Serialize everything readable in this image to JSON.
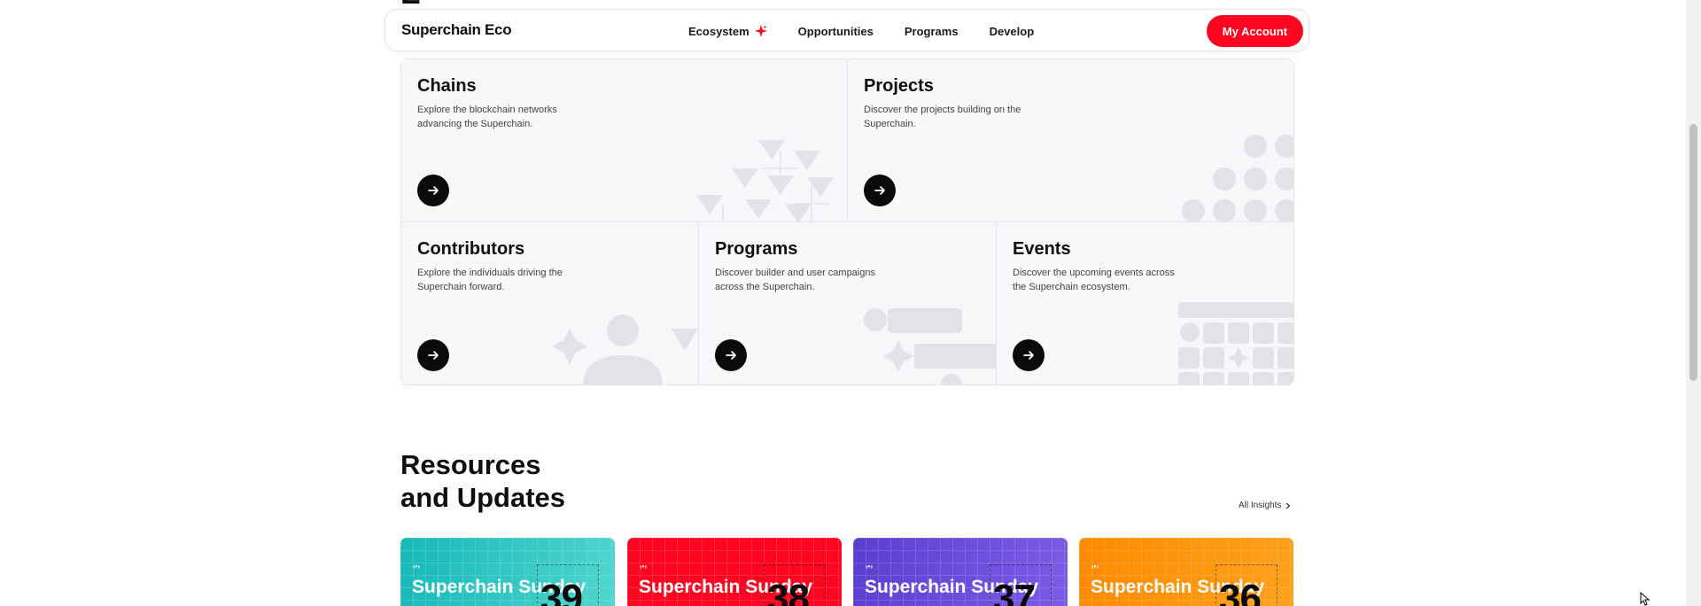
{
  "header": {
    "logo": "Superchain Eco",
    "nav": [
      {
        "label": "Ecosystem",
        "icon": "sparkle-icon"
      },
      {
        "label": "Opportunities"
      },
      {
        "label": "Programs"
      },
      {
        "label": "Develop"
      }
    ],
    "account_label": "My Account"
  },
  "explore": {
    "cards": [
      {
        "title": "Chains",
        "description": "Explore the blockchain networks advancing the Superchain."
      },
      {
        "title": "Projects",
        "description": "Discover the projects building on the Superchain."
      },
      {
        "title": "Contributors",
        "description": "Explore the individuals driving the Superchain forward."
      },
      {
        "title": "Programs",
        "description": "Discover builder and user campaigns across the Superchain."
      },
      {
        "title": "Events",
        "description": "Discover the upcoming events across the Superchain ecosystem."
      }
    ]
  },
  "resources": {
    "title_line1": "Resources",
    "title_line2": "and Updates",
    "all_insights": "All Insights",
    "tiles": [
      {
        "name": "Superchain Sunday",
        "number": "39",
        "color": "#17b8b8"
      },
      {
        "name": "Superchain Sunday",
        "number": "38",
        "color": "#ff0420"
      },
      {
        "name": "Superchain Sunday",
        "number": "37",
        "color": "#5a3fd0"
      },
      {
        "name": "Superchain Sunday",
        "number": "36",
        "color": "#ff8a00"
      }
    ]
  },
  "colors": {
    "accent": "#ff0420",
    "card_bg": "#f7f7f9",
    "deco": "#e2e2e7"
  }
}
